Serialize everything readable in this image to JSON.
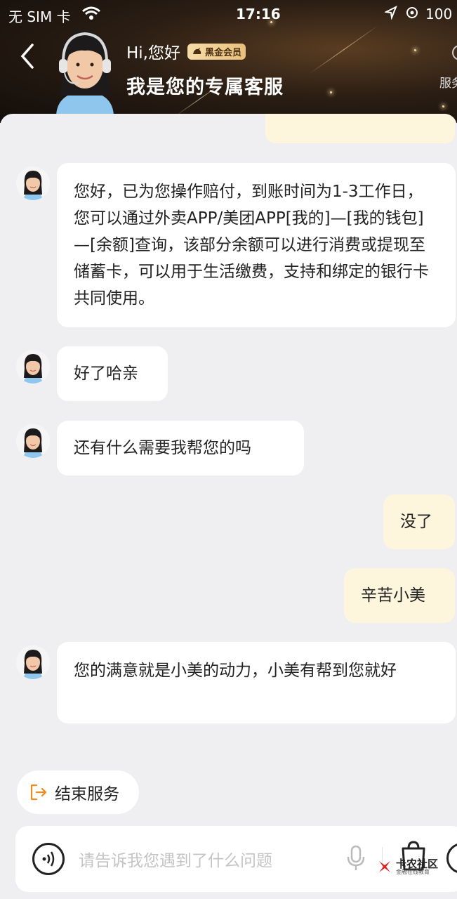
{
  "status_bar": {
    "carrier": "无 SIM 卡",
    "time": "17:16",
    "battery": "100"
  },
  "header": {
    "greeting": "Hi,您好",
    "badge": "黑金会员",
    "title": "我是您的专属客服",
    "service_link": "服务"
  },
  "messages": [
    {
      "from": "agent",
      "text": "您好，已为您操作赔付，到账时间为1-3工作日，您可以通过外卖APP/美团APP[我的]—[我的钱包]—[余额]查询，该部分余额可以进行消费或提现至储蓄卡，可以用于生活缴费，支持和绑定的银行卡共同使用。"
    },
    {
      "from": "agent",
      "text": "好了哈亲"
    },
    {
      "from": "agent",
      "text": "还有什么需要我帮您的吗"
    },
    {
      "from": "user",
      "text": "没了"
    },
    {
      "from": "user",
      "text": "辛苦小美"
    },
    {
      "from": "agent",
      "text": "您的满意就是小美的动力，小美有帮到您就好"
    }
  ],
  "end_service": {
    "label": "结束服务"
  },
  "input": {
    "placeholder": "请告诉我您遇到了什么问题"
  },
  "watermark": {
    "main": "卡农社区",
    "sub": "金融在线教育"
  },
  "colors": {
    "accent_orange": "#f08a1c",
    "user_bubble": "#fdf6dd",
    "badge_gold": "#e9c07c"
  }
}
